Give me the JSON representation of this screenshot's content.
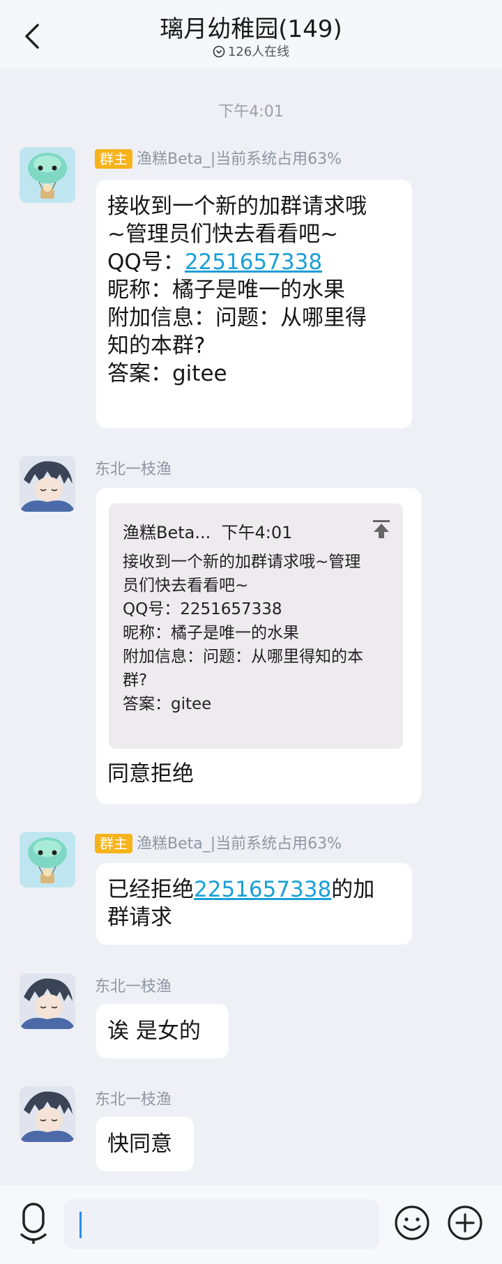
{
  "header": {
    "title": "璃月幼稚园(149)",
    "online": "126人在线"
  },
  "timestamp": "下午4:01",
  "messages": [
    {
      "sender": "渔糕Beta_|当前系统占用63%",
      "badge": "群主",
      "lines": [
        "接收到一个新的加群请求哦",
        "~管理员们快去看看吧~"
      ],
      "qq_label": "QQ号：",
      "qq": "2251657338",
      "rest": [
        "昵称：橘子是唯一的水果",
        "附加信息：问题：从哪里得",
        "知的本群?",
        "答案：gitee"
      ]
    },
    {
      "sender": "东北一枝渔",
      "quote": {
        "author": "渔糕Beta...",
        "time": "下午4:01",
        "lines": [
          "接收到一个新的加群请求哦~管理",
          "员们快去看看吧~",
          "QQ号：2251657338",
          "昵称：橘子是唯一的水果",
          "附加信息：问题：从哪里得知的本",
          "群?",
          "答案：gitee"
        ]
      },
      "text": "同意拒绝"
    },
    {
      "sender": "渔糕Beta_|当前系统占用63%",
      "badge": "群主",
      "pre": "已经拒绝",
      "qq": "2251657338",
      "post": "的加",
      "line2": "群请求"
    },
    {
      "sender": "东北一枝渔",
      "text": "诶 是女的"
    },
    {
      "sender": "东北一枝渔",
      "text": "快同意"
    }
  ],
  "colors": {
    "badge": "#f6b31a",
    "link": "#1a9fd6",
    "cursor": "#2a8be8"
  }
}
